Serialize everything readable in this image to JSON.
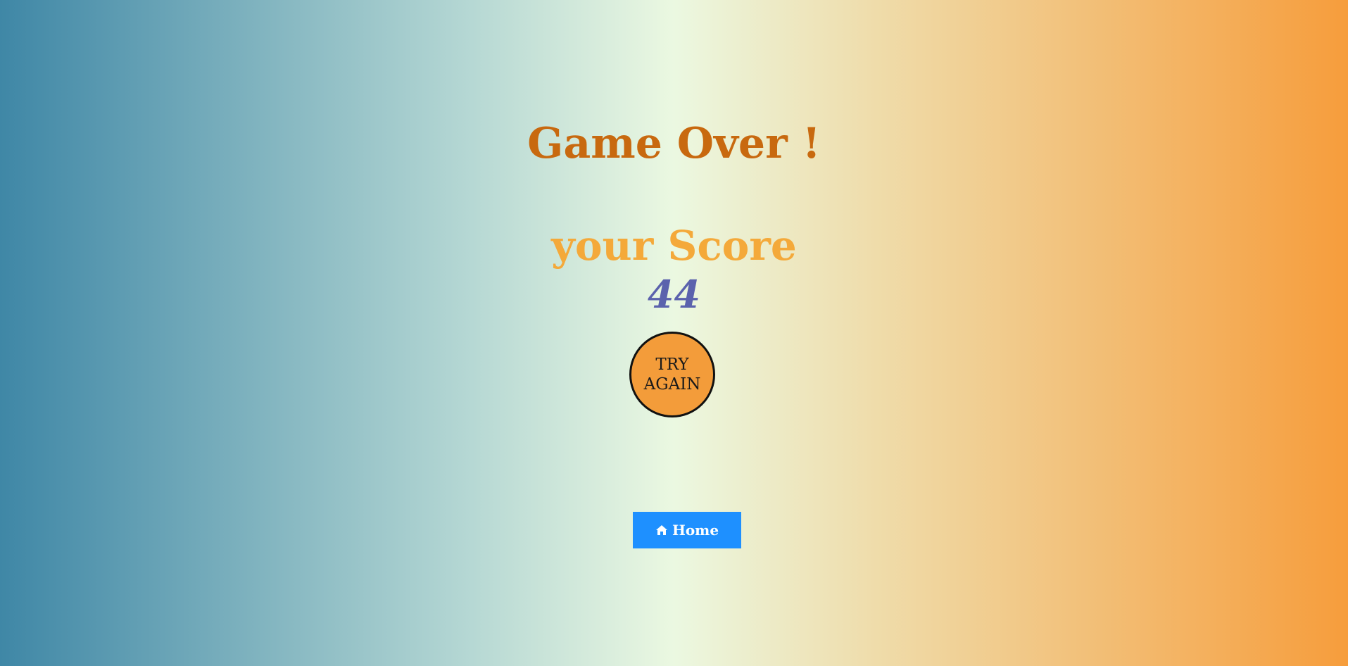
{
  "game_over": {
    "title": "Game Over !",
    "score_label": "your Score",
    "score_value": "44"
  },
  "buttons": {
    "try_again_label": "TRY AGAIN",
    "home_label": "Home",
    "home_icon": "home-icon"
  },
  "colors": {
    "title": "#c8690f",
    "score_label": "#f4a93a",
    "score_value": "#5b62ad",
    "try_again_bg": "#f39c3a",
    "home_bg": "#1e90ff",
    "gradient_left": "#3f87a6",
    "gradient_center": "#ebf8e1",
    "gradient_right": "#f69d3c"
  }
}
